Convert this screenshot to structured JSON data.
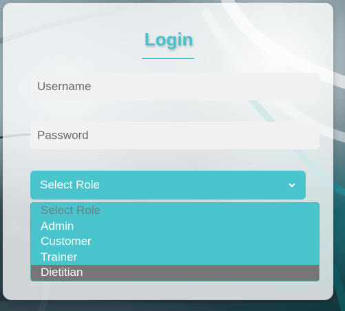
{
  "login": {
    "title": "Login",
    "username_placeholder": "Username",
    "password_placeholder": "Password",
    "role_select": {
      "selected": "Select Role",
      "options": [
        {
          "label": "Select Role",
          "state": "placeholder"
        },
        {
          "label": "Admin",
          "state": "normal"
        },
        {
          "label": "Customer",
          "state": "normal"
        },
        {
          "label": "Trainer",
          "state": "normal"
        },
        {
          "label": "Dietitian",
          "state": "highlighted"
        }
      ]
    }
  },
  "colors": {
    "accent": "#45c2cb",
    "highlight": "#767676",
    "input_bg": "#f1f1f1"
  }
}
